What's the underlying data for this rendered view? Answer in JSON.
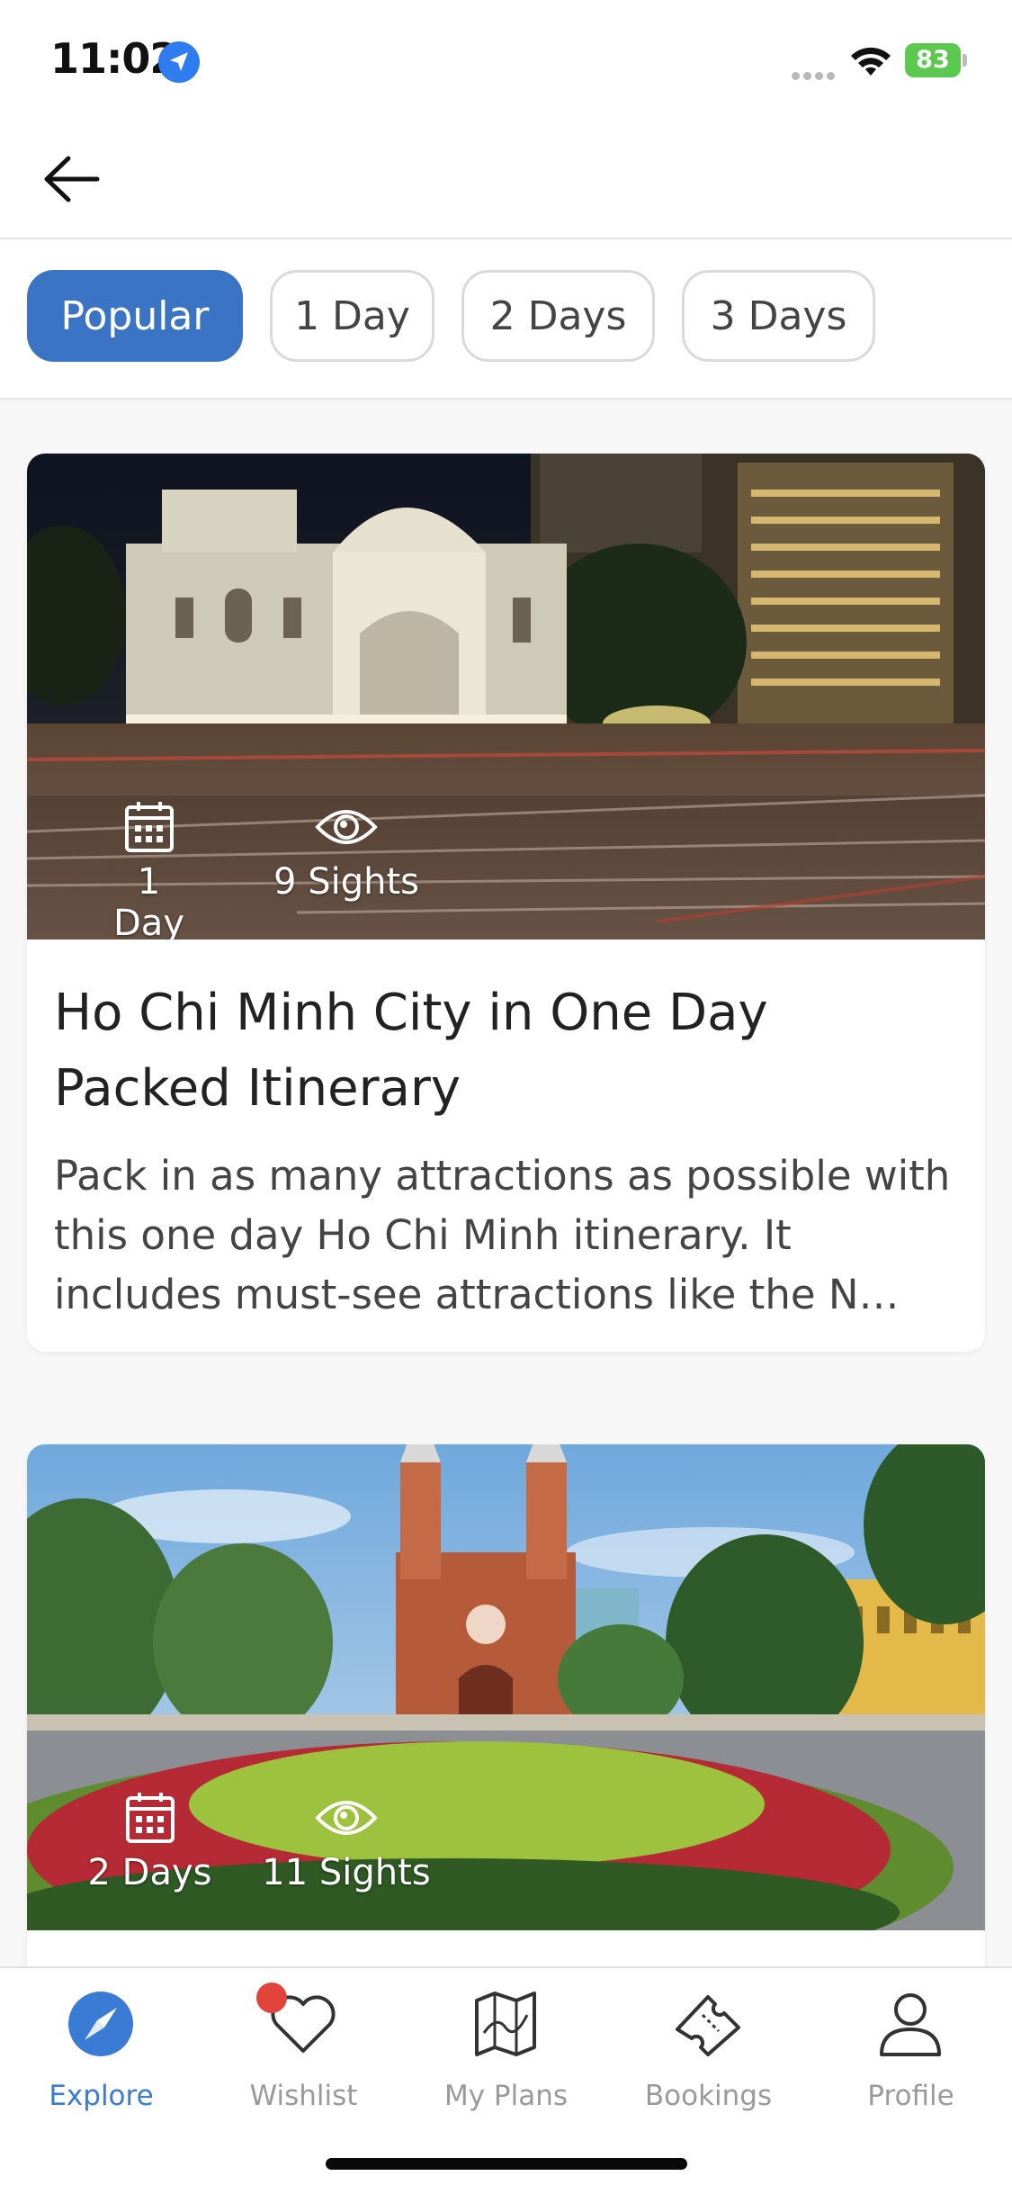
{
  "status_bar": {
    "time": "11:02",
    "battery": "83",
    "icons": [
      "location-arrow-icon",
      "cellular-dots-icon",
      "wifi-icon",
      "battery-charging-icon"
    ]
  },
  "header": {
    "back_icon": "arrow-left-icon"
  },
  "filters": {
    "selected": "Popular",
    "tabs": [
      "Popular",
      "1 Day",
      "2 Days",
      "3 Days"
    ]
  },
  "itineraries": [
    {
      "days": "1 Day",
      "sights": "9 Sights",
      "title": "Ho Chi Minh City in One Day Packed Itinerary",
      "description": "Pack in as many attractions as possible with this one day Ho Chi Minh itinerary. It includes must-see attractions like the N…",
      "image": "Saigon Opera House at night"
    },
    {
      "days": "2 Days",
      "sights": "11 Sights",
      "image": "Notre-Dame Cathedral Basilica of Saigon"
    }
  ],
  "tab_bar": {
    "active": "Explore",
    "tabs": [
      {
        "label": "Explore",
        "icon": "compass-icon"
      },
      {
        "label": "Wishlist",
        "icon": "heart-icon"
      },
      {
        "label": "My Plans",
        "icon": "map-icon"
      },
      {
        "label": "Bookings",
        "icon": "ticket-icon"
      },
      {
        "label": "Profile",
        "icon": "person-icon"
      }
    ]
  },
  "colors": {
    "accent": "#3b74c4",
    "active_tab": "#3a7bd5",
    "inactive_tab": "#9a9a9a",
    "badge": "#e2433b",
    "battery": "#5bc94f"
  }
}
